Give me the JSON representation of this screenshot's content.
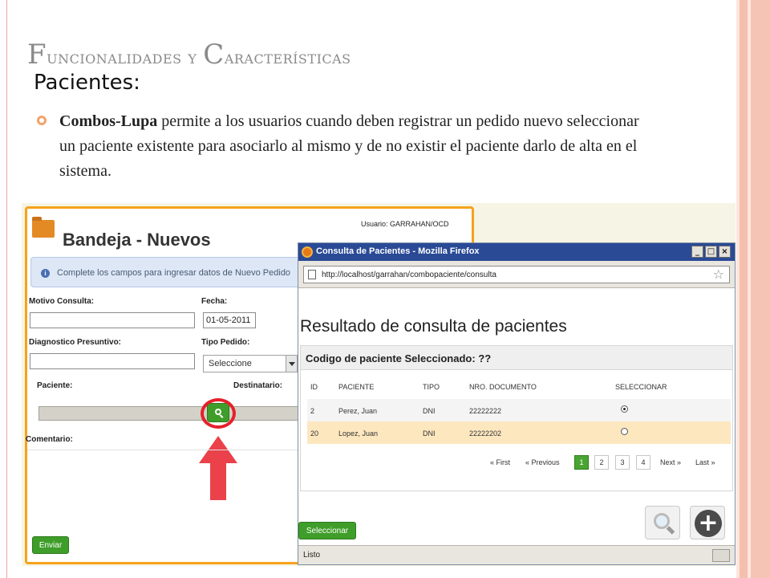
{
  "slide": {
    "title_initial_1": "F",
    "title_rest_1": "uncionalidades y ",
    "title_initial_2": "C",
    "title_rest_2": "aracterísticas",
    "subtitle": "Pacientes:",
    "bullet_bold": "Combos-Lupa",
    "bullet_text": " permite a los usuarios cuando deben registrar un pedido nuevo seleccionar un paciente existente para asociarlo al mismo y de no existir el paciente darlo de alta en el sistema."
  },
  "bandeja": {
    "title": "Bandeja - Nuevos",
    "usuario": "Usuario: GARRAHAN/OCD",
    "info_message": "Complete los campos para ingresar datos de Nuevo Pedido",
    "labels": {
      "motivo_consulta": "Motivo Consulta:",
      "fecha": "Fecha:",
      "diagnostico": "Diagnostico Presuntivo:",
      "tipo_pedido": "Tipo Pedido:",
      "paciente": "Paciente:",
      "destinatario": "Destinatario:",
      "comentario": "Comentario:"
    },
    "fecha_value": "01-05-2011",
    "tipo_pedido_value": "Seleccione",
    "enviar_label": "Enviar",
    "colors": {
      "border": "#f5a31c",
      "button": "#3f9e2a",
      "highlight": "#e6202a"
    }
  },
  "firefox": {
    "window_title": "Consulta de Pacientes - Mozilla Firefox",
    "url": "http://localhost/garrahan/combopaciente/consulta",
    "status": "Listo",
    "page_title": "Resultado de consulta de pacientes",
    "panel_title": "Codigo de paciente Seleccionado: ??",
    "columns": [
      "ID",
      "PACIENTE",
      "TIPO",
      "NRO. DOCUMENTO",
      "SELECCIONAR"
    ],
    "rows": [
      {
        "id": "2",
        "paciente": "Perez, Juan",
        "tipo": "DNI",
        "documento": "22222222",
        "selected": true
      },
      {
        "id": "20",
        "paciente": "Lopez, Juan",
        "tipo": "DNI",
        "documento": "22222202",
        "selected": false
      }
    ],
    "pagination": {
      "first": "« First",
      "previous": "« Previous",
      "pages": [
        "1",
        "2",
        "3",
        "4"
      ],
      "active_page": "1",
      "next": "Next »",
      "last": "Last »"
    },
    "seleccionar_label": "Seleccionar",
    "window_buttons": [
      "_",
      "□",
      "×"
    ],
    "icons": [
      "firefox-icon",
      "page-icon",
      "bookmark-star-icon",
      "search-icon",
      "add-icon"
    ],
    "colors": {
      "titlebar": "#2a4a96",
      "selected_row": "#fde7bf",
      "active_page": "#49a532"
    }
  }
}
